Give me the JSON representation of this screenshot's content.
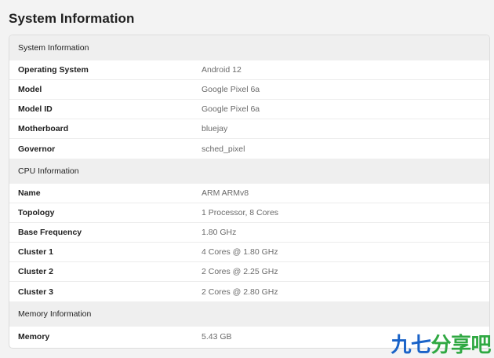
{
  "page": {
    "title": "System Information"
  },
  "sections": [
    {
      "title": "System Information",
      "rows": [
        {
          "label": "Operating System",
          "value": "Android 12"
        },
        {
          "label": "Model",
          "value": "Google Pixel 6a"
        },
        {
          "label": "Model ID",
          "value": "Google Pixel 6a"
        },
        {
          "label": "Motherboard",
          "value": "bluejay"
        },
        {
          "label": "Governor",
          "value": "sched_pixel"
        }
      ]
    },
    {
      "title": "CPU Information",
      "rows": [
        {
          "label": "Name",
          "value": "ARM ARMv8"
        },
        {
          "label": "Topology",
          "value": "1 Processor, 8 Cores"
        },
        {
          "label": "Base Frequency",
          "value": "1.80 GHz"
        },
        {
          "label": "Cluster 1",
          "value": "4 Cores @ 1.80 GHz"
        },
        {
          "label": "Cluster 2",
          "value": "2 Cores @ 2.25 GHz"
        },
        {
          "label": "Cluster 3",
          "value": "2 Cores @ 2.80 GHz"
        }
      ]
    },
    {
      "title": "Memory Information",
      "rows": [
        {
          "label": "Memory",
          "value": "5.43 GB"
        }
      ]
    }
  ],
  "watermark": {
    "text_part1": "九七",
    "text_part2": "分享吧",
    "color_part1": "#1a63c8",
    "color_part2": "#2fa842"
  }
}
